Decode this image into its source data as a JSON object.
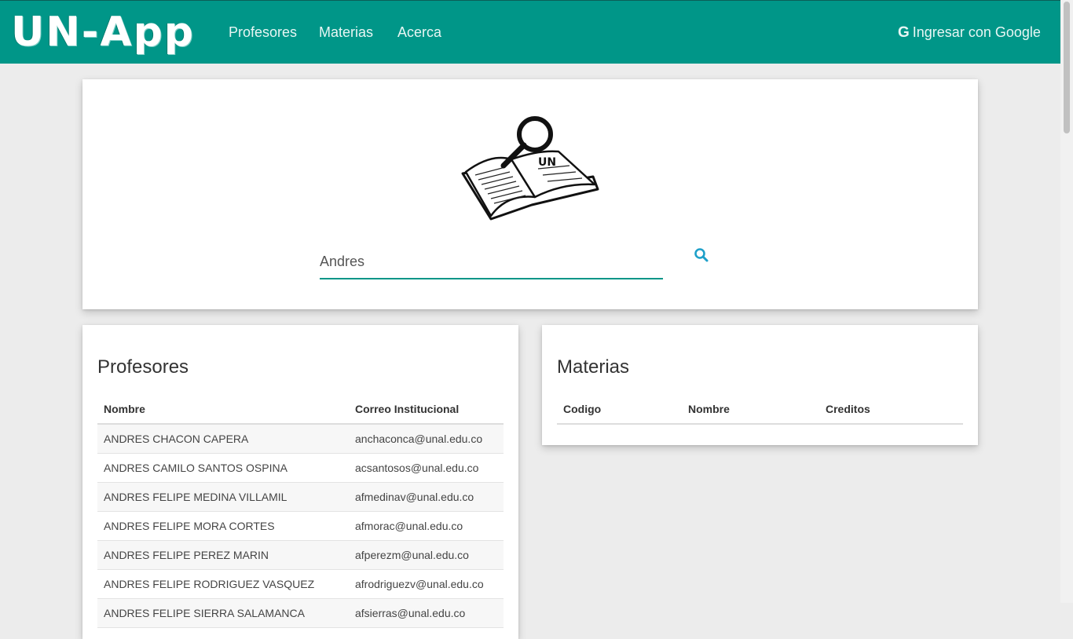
{
  "navbar": {
    "logo": "UN-App",
    "links": [
      "Profesores",
      "Materias",
      "Acerca"
    ],
    "login_icon": "G",
    "login_label": "Ingresar con Google",
    "color": "#009688"
  },
  "search": {
    "value": "Andres",
    "icon": "search-icon",
    "book_logo_text": "UN"
  },
  "profesores": {
    "title": "Profesores",
    "columns": [
      "Nombre",
      "Correo Institucional"
    ],
    "rows": [
      [
        "ANDRES CHACON CAPERA",
        "anchaconca@unal.edu.co"
      ],
      [
        "ANDRES CAMILO SANTOS OSPINA",
        "acsantosos@unal.edu.co"
      ],
      [
        "ANDRES FELIPE MEDINA VILLAMIL",
        "afmedinav@unal.edu.co"
      ],
      [
        "ANDRES FELIPE MORA CORTES",
        "afmorac@unal.edu.co"
      ],
      [
        "ANDRES FELIPE PEREZ MARIN",
        "afperezm@unal.edu.co"
      ],
      [
        "ANDRES FELIPE RODRIGUEZ VASQUEZ",
        "afrodriguezv@unal.edu.co"
      ],
      [
        "ANDRES FELIPE SIERRA SALAMANCA",
        "afsierras@unal.edu.co"
      ]
    ]
  },
  "materias": {
    "title": "Materias",
    "columns": [
      "Codigo",
      "Nombre",
      "Creditos"
    ]
  }
}
